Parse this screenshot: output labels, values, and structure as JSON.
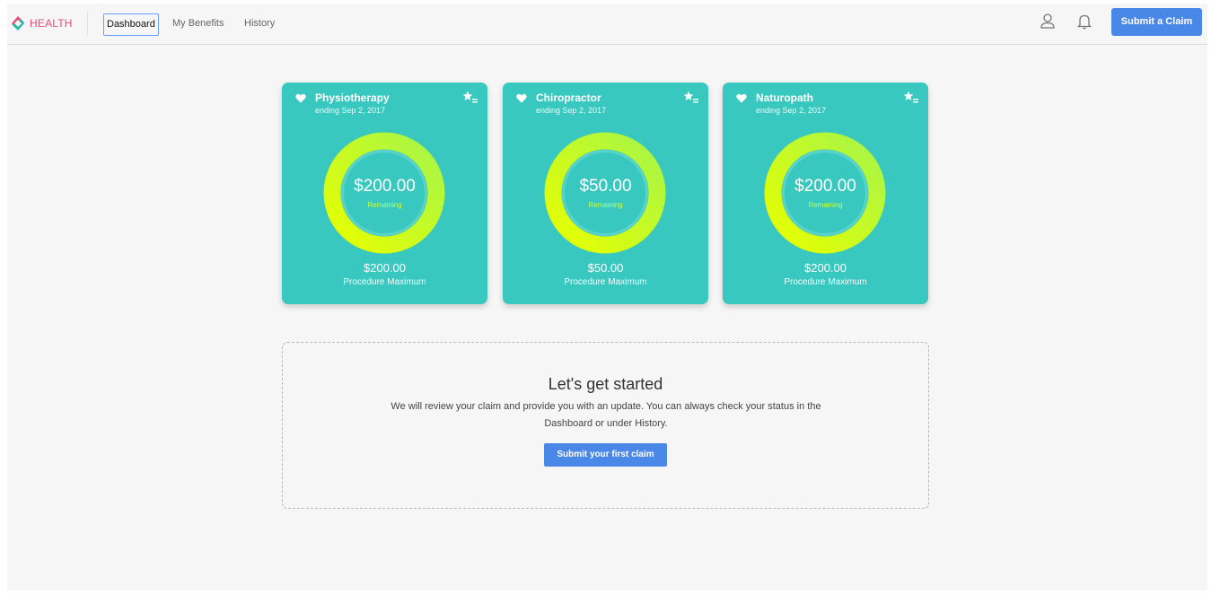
{
  "brand": {
    "name": "HEALTH",
    "logo_color": "#e84b7a"
  },
  "nav": {
    "links": [
      {
        "label": "Dashboard",
        "active": true
      },
      {
        "label": "My Benefits",
        "active": false
      },
      {
        "label": "History",
        "active": false
      }
    ],
    "icons": [
      "user-icon",
      "bell-icon"
    ],
    "submit_label": "Submit a Claim"
  },
  "cards": [
    {
      "title": "Physiotherapy",
      "subtitle": "ending Sep 2, 2017",
      "amount": "$200.00",
      "amount_label": "Remaining",
      "max": "$200.00",
      "max_label": "Procedure Maximum",
      "remaining_fraction": 1.0
    },
    {
      "title": "Chiropractor",
      "subtitle": "ending Sep 2, 2017",
      "amount": "$50.00",
      "amount_label": "Remaining",
      "max": "$50.00",
      "max_label": "Procedure Maximum",
      "remaining_fraction": 1.0
    },
    {
      "title": "Naturopath",
      "subtitle": "ending Sep 2, 2017",
      "amount": "$200.00",
      "amount_label": "Remaining",
      "max": "$200.00",
      "max_label": "Procedure Maximum",
      "remaining_fraction": 1.0
    }
  ],
  "started": {
    "title": "Let's get started",
    "description": "We will review your claim and provide you with an update. You can always check your status in the Dashboard or under History.",
    "button_label": "Submit your first claim"
  },
  "colors": {
    "accent": "#4a88e8",
    "card": "#39c8bf",
    "ring_start": "#e8ff00",
    "ring_end": "#a6f548"
  }
}
